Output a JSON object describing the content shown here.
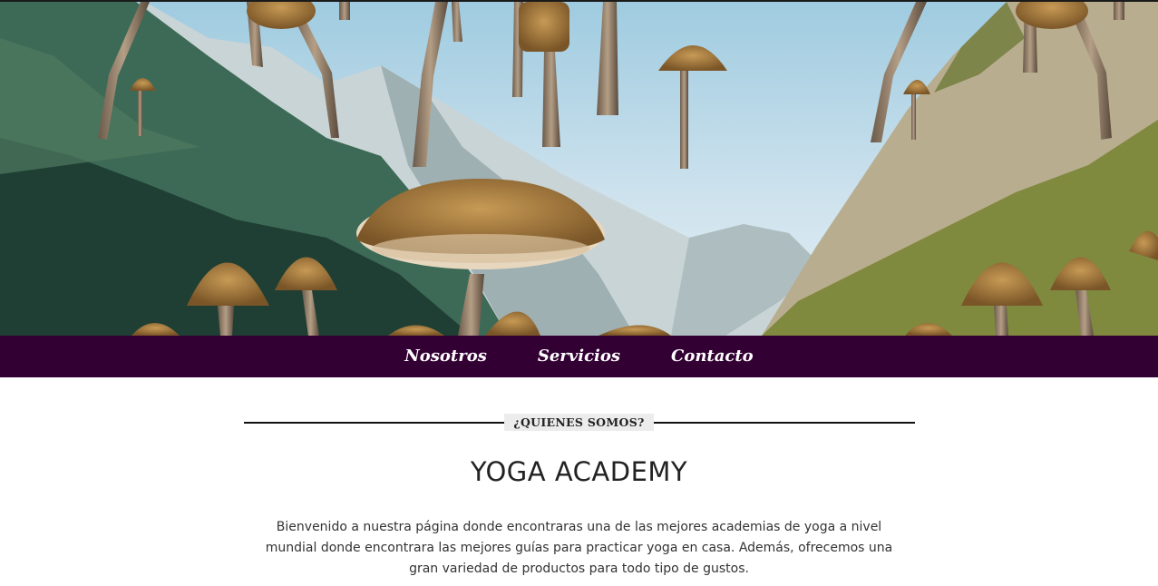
{
  "hero": {
    "image": "mountain-valley-with-floating-mushrooms",
    "colors": {
      "sky": "#cfe3ee",
      "mountain_rock": "#c9d4d6",
      "forest": "#2f5a4a",
      "forest_right": "#7f8a3f",
      "mushroom": "#a57a3e"
    }
  },
  "nav": {
    "background": "#330033",
    "items": [
      {
        "label": "Nosotros"
      },
      {
        "label": "Servicios"
      },
      {
        "label": "Contacto"
      }
    ]
  },
  "section": {
    "eyebrow": "¿QUIENES SOMOS?",
    "title": "YOGA ACADEMY",
    "body": "Bienvenido a nuestra página donde encontraras una de las mejores academias de yoga a nivel mundial donde encontrara las mejores guías para practicar yoga en casa. Además, ofrecemos una gran variedad de productos para todo tipo de gustos."
  }
}
